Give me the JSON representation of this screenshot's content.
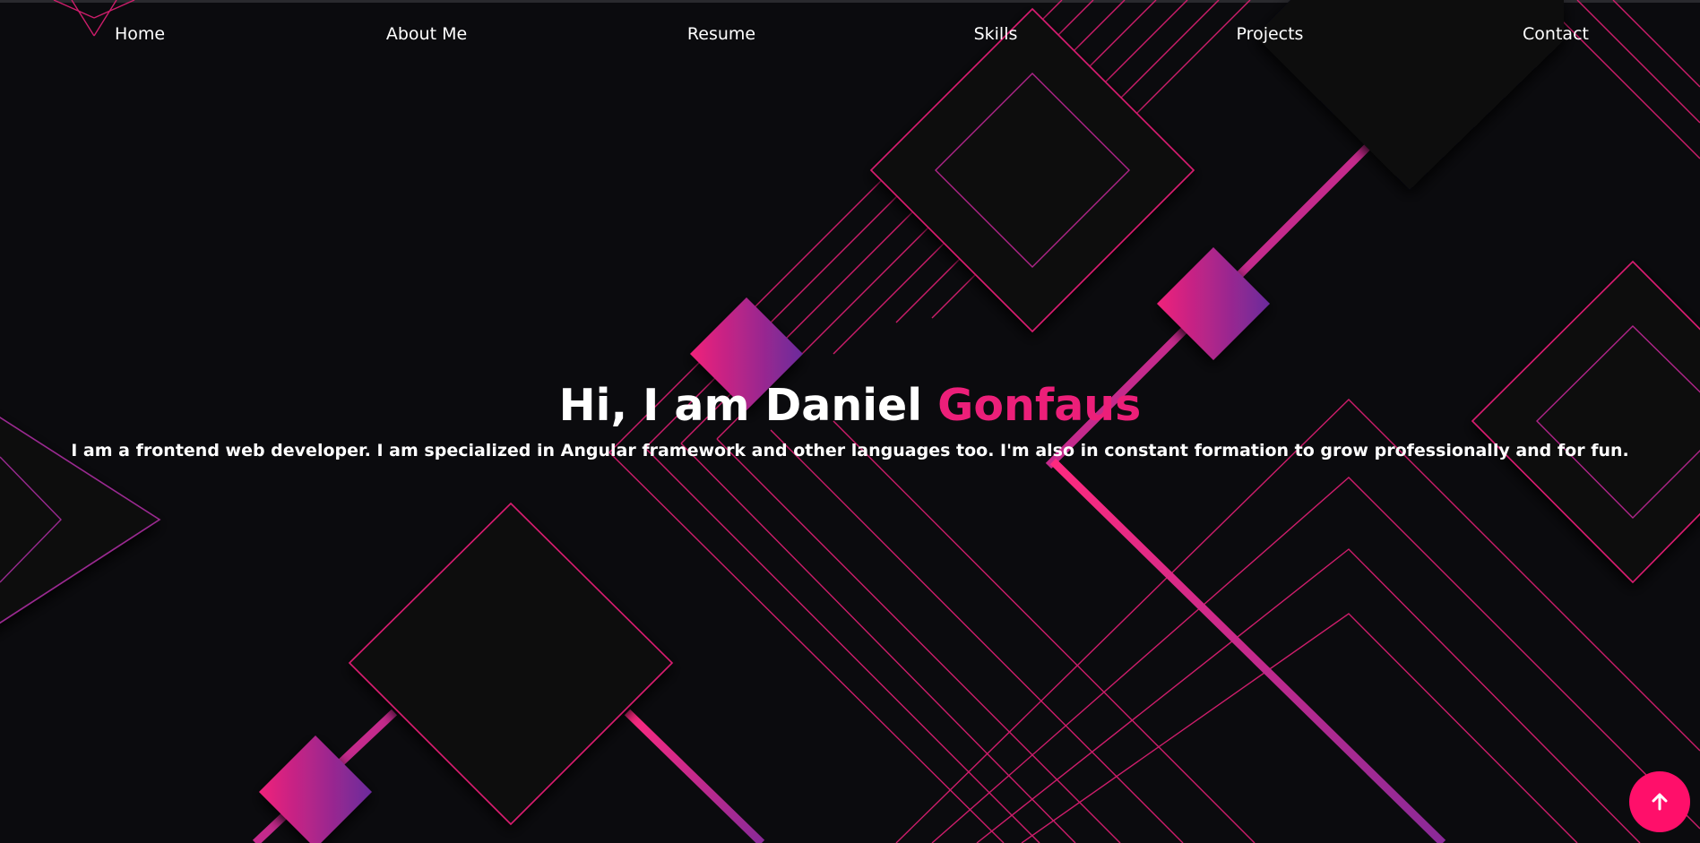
{
  "nav": {
    "items": [
      {
        "label": "Home"
      },
      {
        "label": "About Me"
      },
      {
        "label": "Resume"
      },
      {
        "label": "Skills"
      },
      {
        "label": "Projects"
      },
      {
        "label": "Contact"
      }
    ]
  },
  "hero": {
    "title_prefix": "Hi, I am Daniel ",
    "title_accent": "Gonfaus",
    "subtitle": "I am a frontend web developer. I am specialized in Angular framework and other languages too. I'm also in constant formation to grow professionally and for fun."
  },
  "scroll_top": {
    "icon": "arrow-up-icon"
  },
  "colors": {
    "background": "#0b0b0e",
    "accent": "#ec1f79",
    "line_pink": "#e0206f",
    "line_purple": "#7a2ea0",
    "button": "#ff0f6a",
    "text": "#ffffff"
  }
}
